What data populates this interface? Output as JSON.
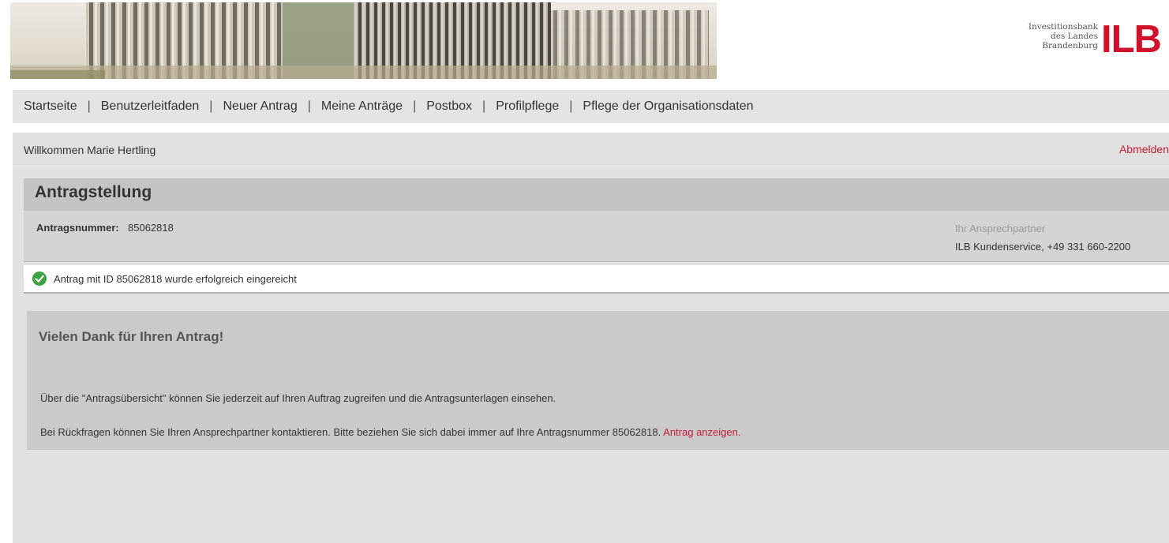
{
  "logo": {
    "line1": "Investitionsbank",
    "line2": "des Landes",
    "line3": "Brandenburg",
    "mark": "ILB",
    "color": "#d0112b"
  },
  "nav": {
    "items": [
      "Startseite",
      "Benutzerleitfaden",
      "Neuer Antrag",
      "Meine Anträge",
      "Postbox",
      "Profilpflege",
      "Pflege der Organisationsdaten"
    ],
    "separator": "|"
  },
  "welcome": {
    "text": "Willkommen Marie Hertling",
    "logout": "Abmelden"
  },
  "page": {
    "title": "Antragstellung",
    "appnr_label": "Antragsnummer:",
    "appnr_value": "85062818",
    "contact_label": "Ihr Ansprechpartner",
    "contact_value": "ILB Kundenservice, +49 331 660-2200"
  },
  "status": {
    "message": "Antrag mit ID 85062818 wurde erfolgreich eingereicht",
    "icon": "check-circle-icon",
    "color": "#3ea33e"
  },
  "thanks": {
    "title": "Vielen Dank für Ihren Antrag!",
    "p1": "Über die \"Antragsübersicht\" können Sie jederzeit auf Ihren Auftrag zugreifen und die Antragsunterlagen einsehen.",
    "p2": "Bei Rückfragen können Sie Ihren Ansprechpartner kontaktieren. Bitte beziehen Sie sich dabei immer auf Ihre Antragsnummer 85062818.",
    "link": "Antrag anzeigen."
  },
  "colors": {
    "accent": "#c41e3a"
  }
}
